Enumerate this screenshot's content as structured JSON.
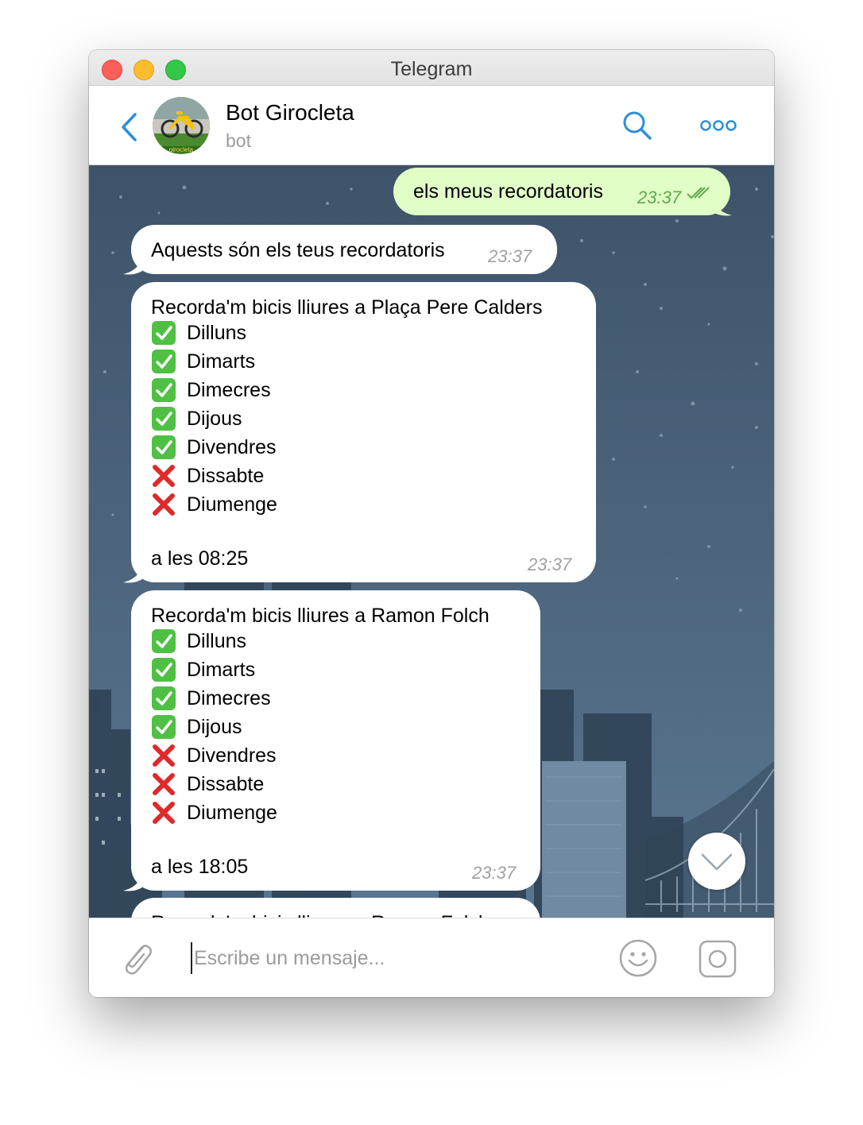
{
  "window": {
    "title": "Telegram"
  },
  "header": {
    "name": "Bot Girocleta",
    "subtitle": "bot",
    "avatar_text": "girocleta"
  },
  "messages": [
    {
      "direction": "out",
      "text": "els meus recordatoris",
      "time": "23:37"
    },
    {
      "direction": "in",
      "text": "Aquests són els teus recordatoris",
      "time": "23:37"
    },
    {
      "direction": "in",
      "title": "Recorda'm bicis lliures a Plaça Pere Calders",
      "days": [
        {
          "label": "Dilluns",
          "on": true
        },
        {
          "label": "Dimarts",
          "on": true
        },
        {
          "label": "Dimecres",
          "on": true
        },
        {
          "label": "Dijous",
          "on": true
        },
        {
          "label": "Divendres",
          "on": true
        },
        {
          "label": "Dissabte",
          "on": false
        },
        {
          "label": "Diumenge",
          "on": false
        }
      ],
      "footer": "a les 08:25",
      "time": "23:37"
    },
    {
      "direction": "in",
      "title": "Recorda'm bicis lliures a Ramon Folch",
      "days": [
        {
          "label": "Dilluns",
          "on": true
        },
        {
          "label": "Dimarts",
          "on": true
        },
        {
          "label": "Dimecres",
          "on": true
        },
        {
          "label": "Dijous",
          "on": true
        },
        {
          "label": "Divendres",
          "on": false
        },
        {
          "label": "Dissabte",
          "on": false
        },
        {
          "label": "Diumenge",
          "on": false
        }
      ],
      "footer": "a les 18:05",
      "time": "23:37"
    },
    {
      "direction": "in",
      "text": "Recorda'm bicis lliures a Ramon Folch",
      "time": "",
      "partial": true
    }
  ],
  "composer": {
    "placeholder": "Escribe un mensaje..."
  },
  "colors": {
    "chat_bg": "#42586e",
    "accent": "#2c8ed6",
    "outgoing_bubble": "#e1fec7",
    "outgoing_time": "#5fa84e",
    "check_green": "#4fc043",
    "cross_red": "#de2a2a"
  },
  "icons": [
    "back-icon",
    "search-icon",
    "more-icon",
    "attach-icon",
    "emoji-icon",
    "camera-icon",
    "chevron-down-icon",
    "read-checkmarks-icon",
    "check-mark-emoji",
    "cross-mark-emoji"
  ]
}
